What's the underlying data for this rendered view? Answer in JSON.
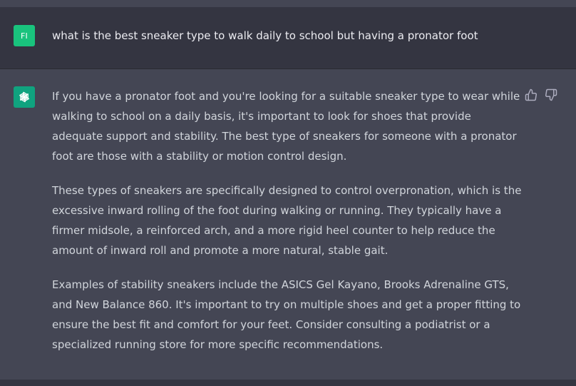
{
  "user_message": {
    "avatar_initials": "FI",
    "text": "what is the best sneaker type to walk daily to school but having a pronator foot"
  },
  "assistant_message": {
    "avatar_icon": "openai-logo-icon",
    "paragraphs": [
      "If you have a pronator foot and you're looking for a suitable sneaker type to wear while walking to school on a daily basis, it's important to look for shoes that provide adequate support and stability. The best type of sneakers for someone with a pronator foot are those with a stability or motion control design.",
      "These types of sneakers are specifically designed to control overpronation, which is the excessive inward rolling of the foot during walking or running. They typically have a firmer midsole, a reinforced arch, and a more rigid heel counter to help reduce the amount of inward roll and promote a more natural, stable gait.",
      "Examples of stability sneakers include the ASICS Gel Kayano, Brooks Adrenaline GTS, and New Balance 860. It's important to try on multiple shoes and get a proper fitting to ensure the best fit and comfort for your feet. Consider consulting a podiatrist or a specialized running store for more specific recommendations."
    ]
  },
  "feedback": {
    "thumbs_up_icon": "thumbs-up-icon",
    "thumbs_down_icon": "thumbs-down-icon"
  },
  "colors": {
    "page_background": "#343541",
    "assistant_background": "#444654",
    "user_avatar": "#19c37d",
    "assistant_avatar": "#10a37f",
    "assistant_text": "#d1d5db",
    "user_text": "#ececf1",
    "icon": "#acacbe"
  }
}
